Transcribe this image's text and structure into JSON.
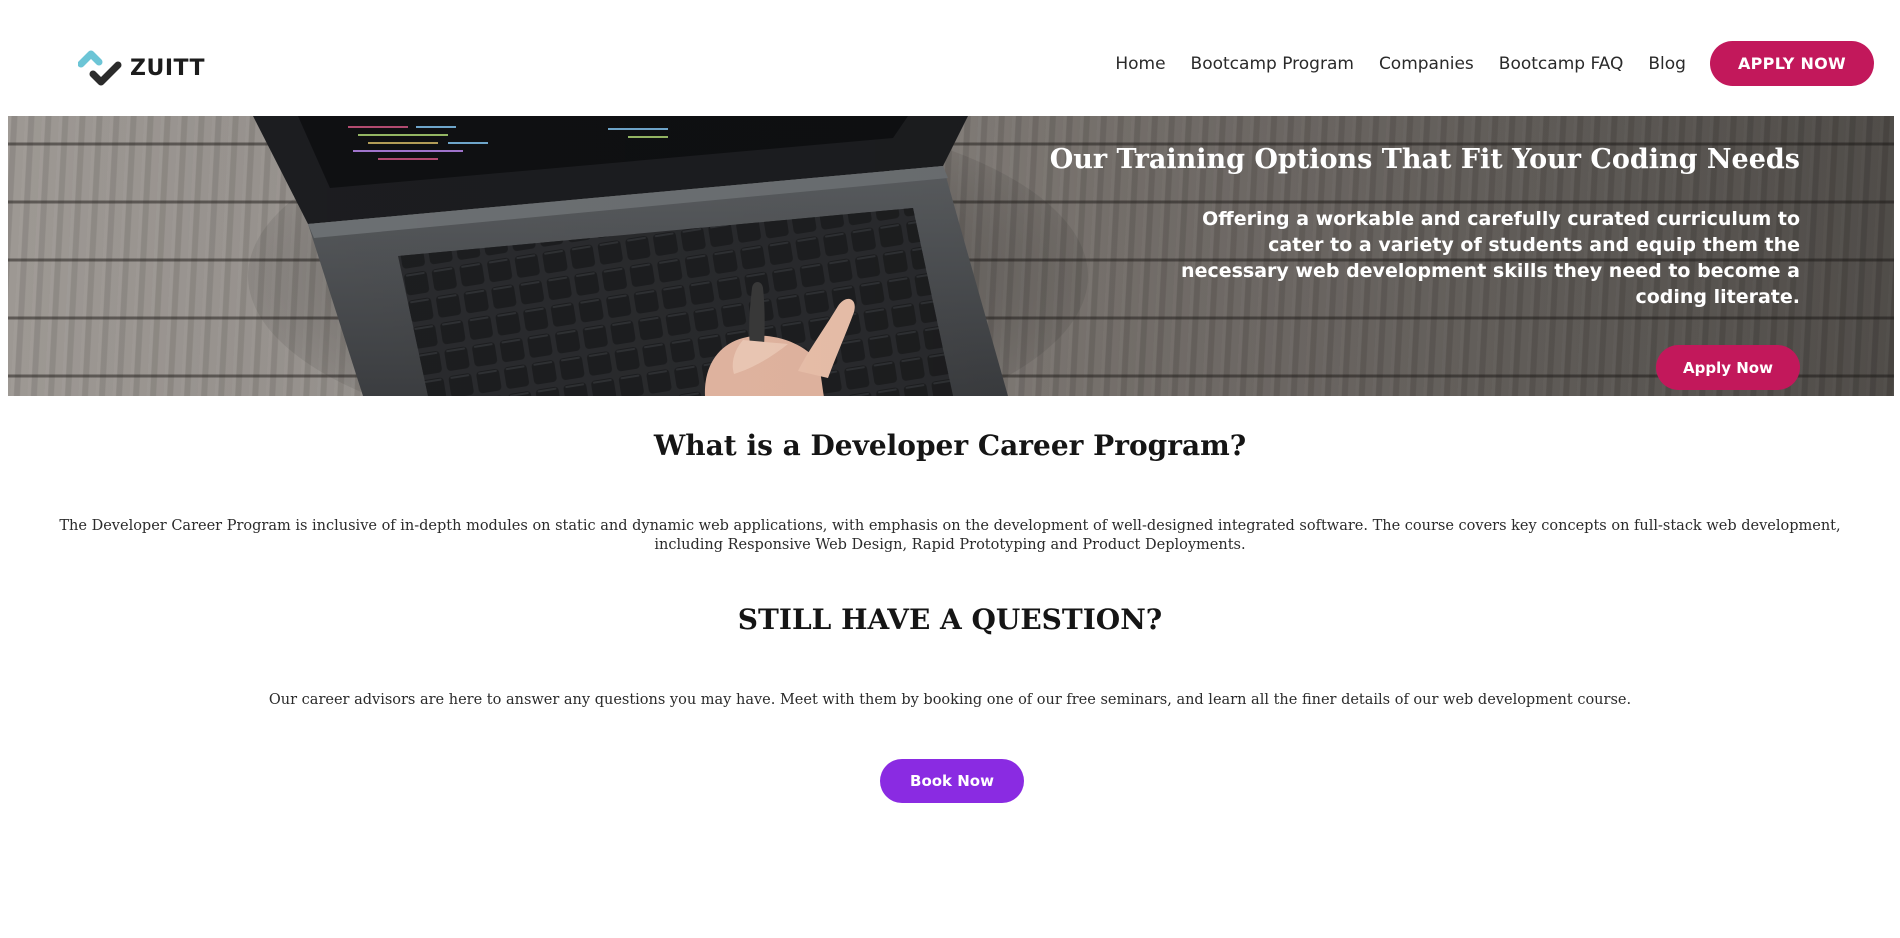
{
  "brand": {
    "name": "ZUITT",
    "colors": {
      "primary": "#c2185b",
      "secondary": "#8a2be2",
      "logo_teal": "#6cc5d6"
    }
  },
  "nav": {
    "items": [
      {
        "label": "Home"
      },
      {
        "label": "Bootcamp Program"
      },
      {
        "label": "Companies"
      },
      {
        "label": "Bootcamp FAQ"
      },
      {
        "label": "Blog"
      }
    ],
    "apply_label": "APPLY NOW"
  },
  "hero": {
    "title": "Our Training Options That Fit Your Coding Needs",
    "subtitle": "Offering a workable and carefully curated curriculum to cater to a variety of students and equip them the necessary web development skills they need to become a coding literate.",
    "button_label": "Apply Now",
    "image": "laptop-keyboard-photo"
  },
  "about": {
    "title": "What is a Developer Career Program?",
    "text": "The Developer Career Program is inclusive of in-depth modules on static and dynamic web applications, with emphasis on the development of well-designed integrated software. The course covers key concepts on full-stack web development, including Responsive Web Design, Rapid Prototyping and Product Deployments."
  },
  "question": {
    "title": "STILL HAVE A QUESTION?",
    "text": "Our career advisors are here to answer any questions you may have. Meet with them by booking one of our free seminars, and learn all the finer details of our web development course.",
    "button_label": "Book Now"
  }
}
